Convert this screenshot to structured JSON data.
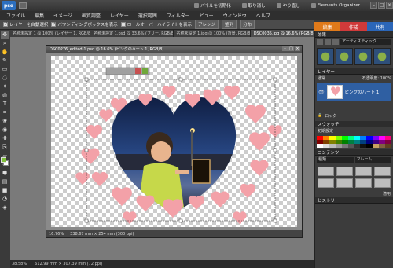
{
  "app": {
    "logo": "pse",
    "title_buttons": [
      {
        "label": "パネルを初期化"
      },
      {
        "label": "取り消し"
      },
      {
        "label": "やり直し"
      },
      {
        "label": "Elements Organizer"
      }
    ]
  },
  "menu": [
    "ファイル",
    "編集",
    "イメージ",
    "画質調整",
    "レイヤー",
    "選択範囲",
    "フィルター",
    "ビュー",
    "ウィンドウ",
    "ヘルプ"
  ],
  "options": {
    "auto_select": "レイヤーを自動選択",
    "show_bbox": "バウンディングボックスを表示",
    "rollover": "ロールオーバーハイライトを表示",
    "arrange": "アレンジ",
    "align": "整列",
    "distribute": "分布"
  },
  "mode_tabs": [
    "編集",
    "作成",
    "共有"
  ],
  "doc_tabs": [
    "名称未設定 1 @ 100% (レイヤー 1, RGB/8)",
    "名称未設定 1.psd @ 33.6% (フリー, RGB/8)",
    "名称未設定 1.jpg @ 100% (背景, RGB/8)",
    "DSC0035.jpg @ 16.6% (RGB/8)"
  ],
  "doc": {
    "title": "DSC0276_edited-1.psd @ 16.6% (ピンクのハート 1, RGB/8)",
    "zoom": "16.76%",
    "dims": "338.67 mm × 254 mm (300 ppi)"
  },
  "bottom_status": {
    "zoom": "38.58%",
    "dims": "612.99 mm × 307.39 mm (72 ppi)"
  },
  "panels": {
    "effects": {
      "title": "効果",
      "filter": "アーティスティック"
    },
    "layers": {
      "title": "レイヤー",
      "mode": "通常",
      "opacity": "不透明度: 100%",
      "layer_name": "ピンクのハート 1",
      "lock": "ロック"
    },
    "swatches": {
      "title": "スウォッチ",
      "preset": "初期設定"
    },
    "content": {
      "title": "コンテンツ",
      "type": "種類",
      "category": "フレーム",
      "apply": "適用"
    },
    "history": {
      "title": "ヒストリー"
    }
  },
  "colors": {
    "foreground": "#7fbf3a",
    "background": "#ffffff",
    "heart": "#f3a1a8",
    "edit_tab": "#e07a1a"
  }
}
